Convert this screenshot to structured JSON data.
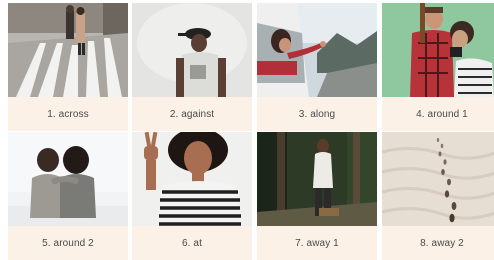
{
  "cards": [
    {
      "label": "1. across"
    },
    {
      "label": "2. against"
    },
    {
      "label": "3. along"
    },
    {
      "label": "4. around 1"
    },
    {
      "label": "5. around 2"
    },
    {
      "label": "6. at"
    },
    {
      "label": "7. away 1"
    },
    {
      "label": "8. away 2"
    }
  ],
  "colors": {
    "caption_background": "#fbf1e6",
    "caption_text": "#4a4a4a"
  }
}
